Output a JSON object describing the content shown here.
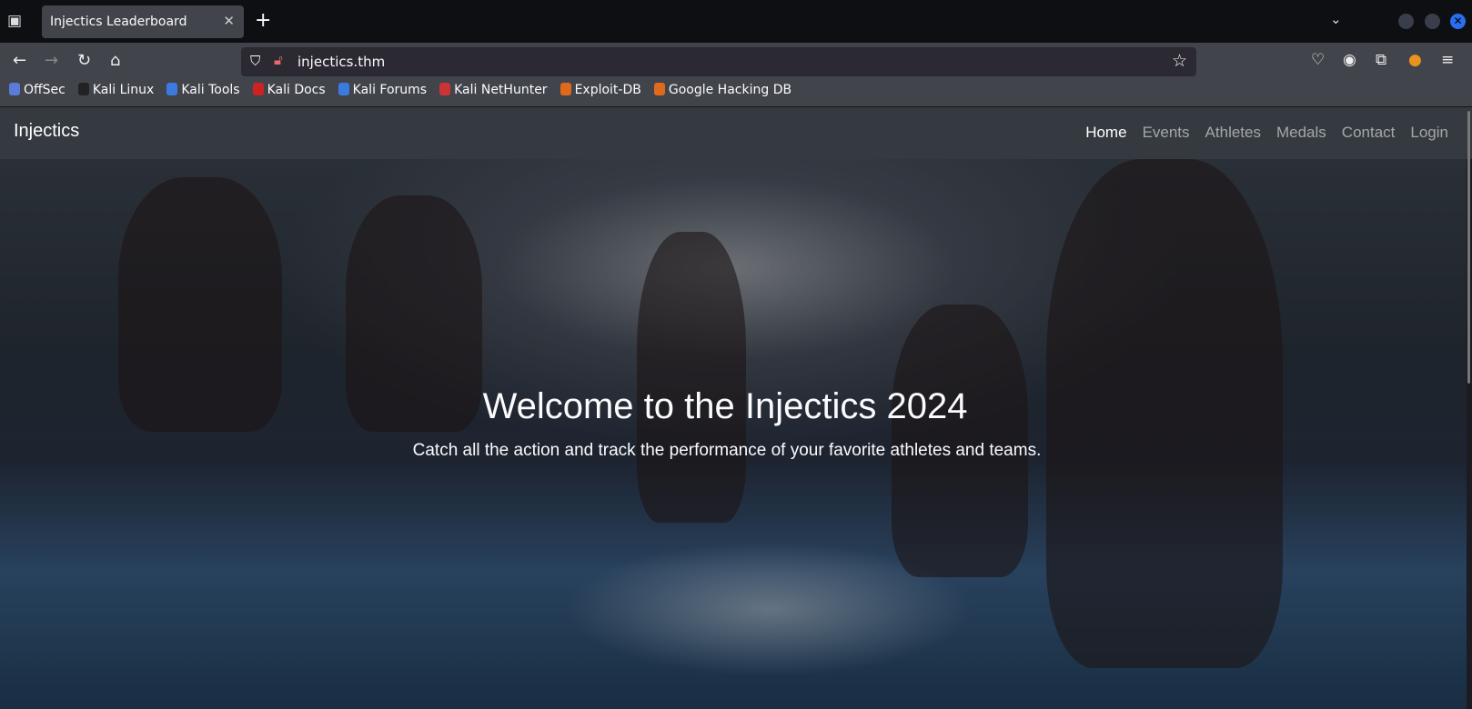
{
  "browser": {
    "tab_title": "Injectics Leaderboard",
    "url": "injectics.thm",
    "bookmarks": [
      {
        "label": "OffSec",
        "color": "#5a7bd8"
      },
      {
        "label": "Kali Linux",
        "color": "#222"
      },
      {
        "label": "Kali Tools",
        "color": "#3b7be0"
      },
      {
        "label": "Kali Docs",
        "color": "#c22"
      },
      {
        "label": "Kali Forums",
        "color": "#3b7be0"
      },
      {
        "label": "Kali NetHunter",
        "color": "#c33"
      },
      {
        "label": "Exploit-DB",
        "color": "#e06a1c"
      },
      {
        "label": "Google Hacking DB",
        "color": "#e06a1c"
      }
    ]
  },
  "site": {
    "brand": "Injectics",
    "nav": [
      "Home",
      "Events",
      "Athletes",
      "Medals",
      "Contact",
      "Login"
    ],
    "hero_title": "Welcome to the Injectics 2024",
    "hero_subtitle": "Catch all the action and track the performance of your favorite athletes and teams."
  }
}
